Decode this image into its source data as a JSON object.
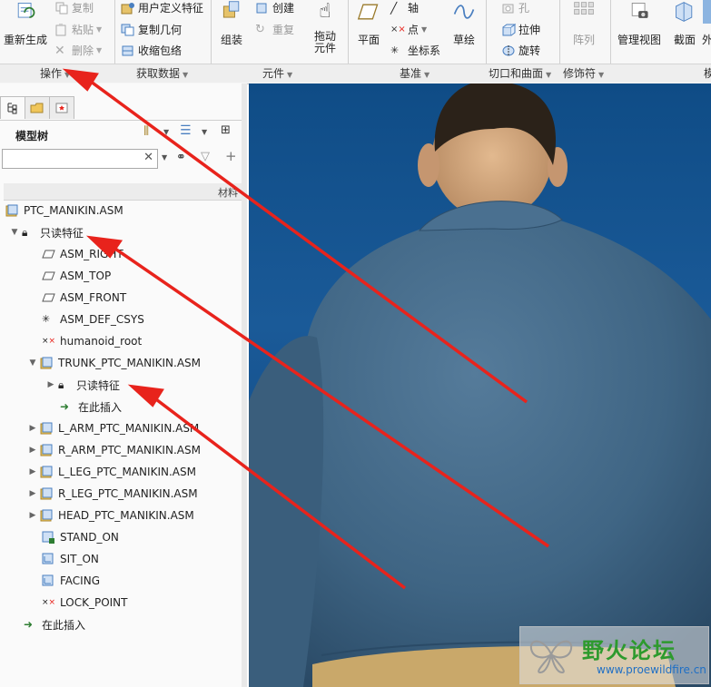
{
  "ribbon": {
    "regenerate_label": "重新生成",
    "copy_label": "复制",
    "paste_label": "粘贴",
    "delete_label": "删除",
    "user_defined_feature_label": "用户定义特征",
    "copy_geometry_label": "复制几何",
    "shrinkwrap_label": "收缩包络",
    "create_label": "创建",
    "redo_label": "重复",
    "assemble_label": "组装",
    "drag_components_label": "拖动\n元件",
    "plane_label": "平面",
    "axis_label": "轴",
    "point_label": "点",
    "csys_label": "坐标系",
    "sketch_label": "草绘",
    "hole_label": "孔",
    "extrude_label": "拉伸",
    "revolve_label": "旋转",
    "pattern_label": "阵列",
    "manage_views_label": "管理视图",
    "section_label": "截面",
    "appearance_label": "外",
    "groups": {
      "operations": "操作",
      "get_data": "获取数据",
      "component": "元件",
      "datum": "基准",
      "cut_surface": "切口和曲面",
      "modifiers": "修饰符",
      "partial_next": "模"
    }
  },
  "panel": {
    "tree_title": "模型树",
    "search_value": "",
    "column_header": "材料"
  },
  "tree": {
    "root": "PTC_MANIKIN.ASM",
    "readonly_feature": "只读特征",
    "asm_right": "ASM_RIGHT",
    "asm_top": "ASM_TOP",
    "asm_front": "ASM_FRONT",
    "asm_def_csys": "ASM_DEF_CSYS",
    "humanoid_root": "humanoid_root",
    "trunk": "TRUNK_PTC_MANIKIN.ASM",
    "trunk_readonly": "只读特征",
    "trunk_insert_here": "在此插入",
    "l_arm": "L_ARM_PTC_MANIKIN.ASM",
    "r_arm": "R_ARM_PTC_MANIKIN.ASM",
    "l_leg": "L_LEG_PTC_MANIKIN.ASM",
    "r_leg": "R_LEG_PTC_MANIKIN.ASM",
    "head": "HEAD_PTC_MANIKIN.ASM",
    "stand_on": "STAND_ON",
    "sit_on": "SIT_ON",
    "facing": "FACING",
    "lock_point": "LOCK_POINT",
    "insert_here": "在此插入"
  },
  "watermark": {
    "title": "野火论坛",
    "url": "www.proewildfire.cn"
  },
  "colors": {
    "viewport_bg": "#0f4c86",
    "shirt": "#3f6584",
    "annotation_arrow": "#e8231c",
    "watermark_green": "#2d9a2d"
  }
}
